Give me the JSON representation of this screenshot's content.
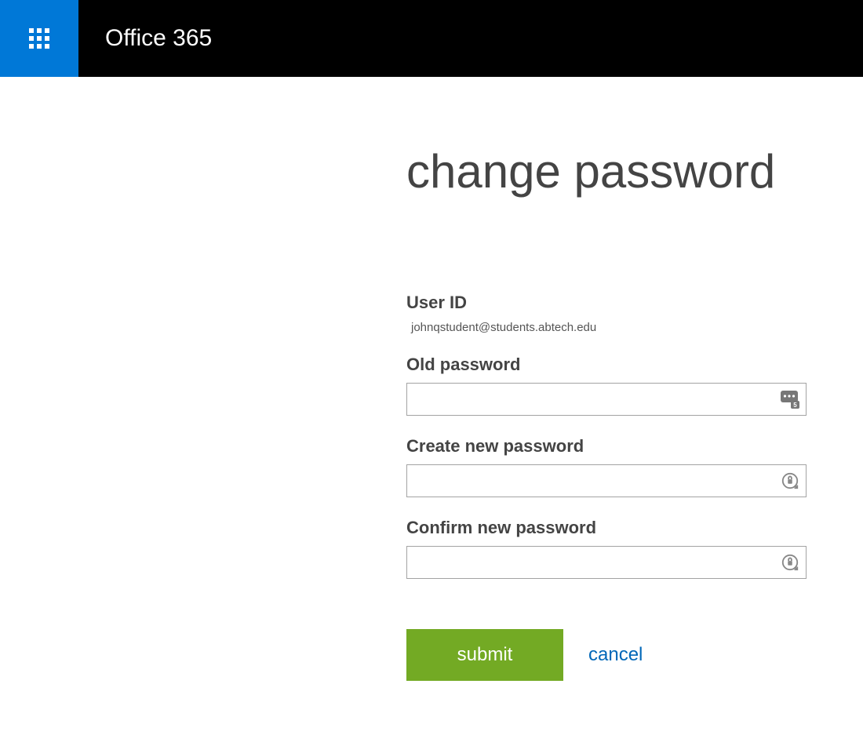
{
  "header": {
    "app_title": "Office 365"
  },
  "page": {
    "heading": "change password"
  },
  "form": {
    "user_id_label": "User ID",
    "user_id_value": "johnqstudent@students.abtech.edu",
    "old_password_label": "Old password",
    "old_password_value": "",
    "new_password_label": "Create new password",
    "new_password_value": "",
    "confirm_password_label": "Confirm new password",
    "confirm_password_value": ""
  },
  "actions": {
    "submit_label": "submit",
    "cancel_label": "cancel"
  }
}
